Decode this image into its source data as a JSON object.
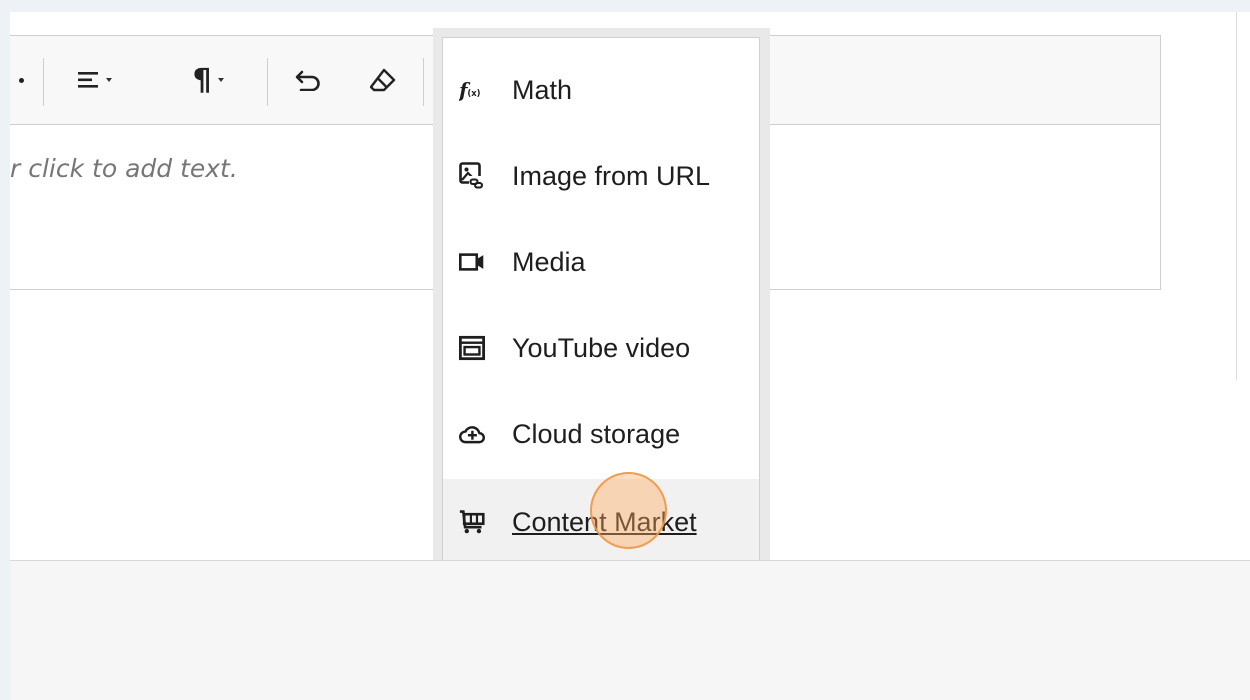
{
  "editor": {
    "placeholder_text": "r click to add text."
  },
  "toolbar": {
    "buttons": [
      {
        "name": "list-dropdown",
        "icon": "bullet-list-icon"
      },
      {
        "name": "align-dropdown",
        "icon": "align-left-icon"
      },
      {
        "name": "paragraph-dropdown",
        "icon": "pilcrow-icon",
        "glyph": "¶"
      },
      {
        "name": "undo",
        "icon": "undo-icon"
      },
      {
        "name": "clear-formatting",
        "icon": "eraser-icon"
      }
    ]
  },
  "insert_menu": {
    "items": [
      {
        "label": "Math",
        "icon": "function-icon"
      },
      {
        "label": "Image from URL",
        "icon": "image-link-icon"
      },
      {
        "label": "Media",
        "icon": "video-camera-icon"
      },
      {
        "label": "YouTube video",
        "icon": "embed-window-icon"
      },
      {
        "label": "Cloud storage",
        "icon": "cloud-add-icon"
      },
      {
        "label": "Content Market",
        "icon": "cart-icon",
        "hovered": true
      }
    ]
  },
  "colors": {
    "background": "#eef1f6",
    "cursor_highlight": "#f0a050"
  }
}
